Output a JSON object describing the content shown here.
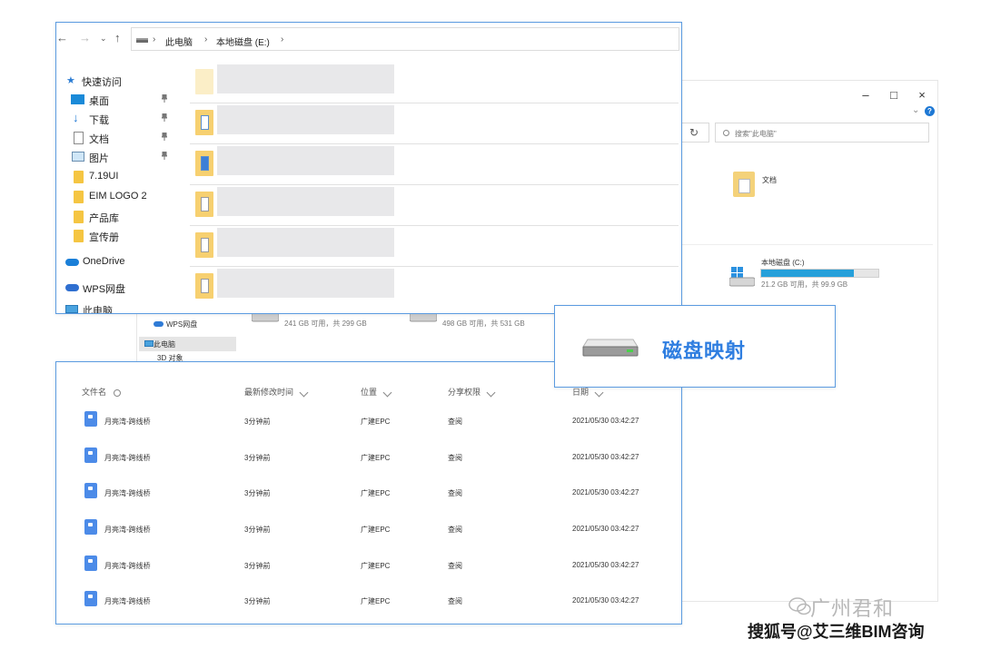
{
  "background_window": {
    "controls": [
      "–",
      "□",
      "×"
    ],
    "refresh_icon": "refresh-icon",
    "search_placeholder": "搜索\"此电脑\"",
    "documents_label": "文档",
    "drive_c": {
      "name": "本地磁盘 (C:)",
      "free_text": "21.2 GB 可用，共 99.9 GB",
      "used_fraction": 0.79
    },
    "drive_2_free": "241 GB 可用，共 299 GB",
    "drive_3_free": "498 GB 可用，共 531 GB",
    "nav": {
      "wps": "WPS网盘",
      "this_pc": "此电脑",
      "objects3d": "3D 对象"
    }
  },
  "explorer": {
    "breadcrumb": [
      "此电脑",
      "本地磁盘 (E:)"
    ],
    "sidebar": {
      "quick_access": "快速访问",
      "items": [
        "桌面",
        "下载",
        "文档",
        "图片",
        "7.19UI",
        "EIM LOGO 2",
        "产品库",
        "宣传册"
      ],
      "onedrive": "OneDrive",
      "wps": "WPS网盘",
      "partial": "此电脑"
    },
    "file_count": 6
  },
  "callout": {
    "text": "磁盘映射",
    "icon": "hard-drive-icon"
  },
  "shared_files": {
    "columns": {
      "name": "文件名",
      "modified": "最新修改时间",
      "location": "位置",
      "permission": "分享权限",
      "date": "日期"
    },
    "rows": [
      {
        "name": "月亮湾-跨线桥",
        "modified": "3分钟前",
        "location": "广建EPC",
        "permission": "查阅",
        "date": "2021/05/30 03:42:27"
      },
      {
        "name": "月亮湾-跨线桥",
        "modified": "3分钟前",
        "location": "广建EPC",
        "permission": "查阅",
        "date": "2021/05/30 03:42:27"
      },
      {
        "name": "月亮湾-跨线桥",
        "modified": "3分钟前",
        "location": "广建EPC",
        "permission": "查阅",
        "date": "2021/05/30 03:42:27"
      },
      {
        "name": "月亮湾-跨线桥",
        "modified": "3分钟前",
        "location": "广建EPC",
        "permission": "查阅",
        "date": "2021/05/30 03:42:27"
      },
      {
        "name": "月亮湾-跨线桥",
        "modified": "3分钟前",
        "location": "广建EPC",
        "permission": "查阅",
        "date": "2021/05/30 03:42:27"
      },
      {
        "name": "月亮湾-跨线桥",
        "modified": "3分钟前",
        "location": "广建EPC",
        "permission": "查阅",
        "date": "2021/05/30 03:42:27"
      }
    ]
  },
  "watermark": {
    "line1": "广州君和",
    "line2": "搜狐号@艾三维BIM咨询"
  },
  "colors": {
    "accent": "#2f7ee0",
    "border": "#5b9be0",
    "folder": "#f5c542"
  }
}
